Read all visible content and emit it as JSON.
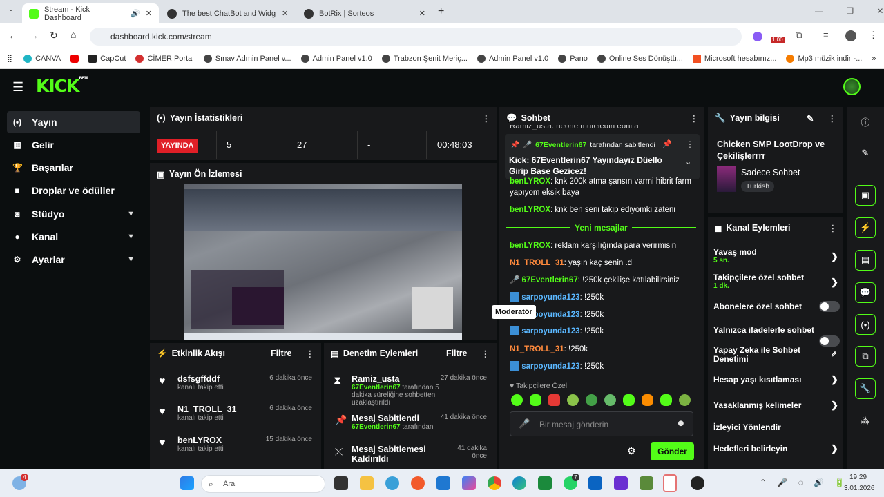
{
  "browser": {
    "tabs": [
      {
        "label": "Stream - Kick Dashboard"
      },
      {
        "label": "The best ChatBot and Widgets"
      },
      {
        "label": "BotRix | Sorteos"
      }
    ],
    "url": "dashboard.kick.com/stream",
    "ext_badge": "1.00",
    "bookmarks": [
      "CANVA",
      "CapCut",
      "CİMER Portal",
      "Sınav Admin Panel v...",
      "Admin Panel v1.0",
      "Trabzon Şenit Meriç...",
      "Admin Panel v1.0",
      "Pano",
      "Online Ses Dönüştü...",
      "Microsoft hesabınız...",
      "Mp3 müzik indir -..."
    ]
  },
  "app": {
    "logo": "KICK",
    "beta": "BETA",
    "nav": [
      {
        "label": "Yayın"
      },
      {
        "label": "Gelir"
      },
      {
        "label": "Başarılar"
      },
      {
        "label": "Droplar ve ödüller"
      },
      {
        "label": "Stüdyo"
      },
      {
        "label": "Kanal"
      },
      {
        "label": "Ayarlar"
      }
    ],
    "stats": {
      "title": "Yayın İstatistikleri",
      "live": "YAYINDA",
      "v1": "5",
      "v2": "27",
      "v3": "-",
      "time": "00:48:03"
    },
    "preview": {
      "title": "Yayın Ön İzlemesi"
    },
    "activity": {
      "title": "Etkinlik Akışı",
      "filter": "Filtre",
      "items": [
        {
          "user": "dsfsgffddf",
          "desc": "kanalı takip etti",
          "time": "6 dakika önce"
        },
        {
          "user": "N1_TROLL_31",
          "desc": "kanalı takip etti",
          "time": "6 dakika önce"
        },
        {
          "user": "benLYROX",
          "desc": "kanalı takip etti",
          "time": "15 dakika önce"
        }
      ]
    },
    "mod": {
      "title": "Denetim Eylemleri",
      "filter": "Filtre",
      "items": [
        {
          "user": "Ramiz_usta",
          "desc_user": "67Eventlerin67",
          "desc": "tarafından 5 dakika süreliğine sohbetten uzaklaştırıldı",
          "time": "27 dakika önce"
        },
        {
          "user": "Mesaj Sabitlendi",
          "desc_user": "67Eventlerin67",
          "desc": "tarafından",
          "time": "41 dakika önce"
        },
        {
          "user": "Mesaj Sabitlemesi Kaldırıldı",
          "time": "41 dakika önce"
        }
      ]
    },
    "chat": {
      "title": "Sohbet",
      "top_cut": "Ramiz_usta: neone müteledin ebni a",
      "pinned_by": "67Eventlerin67",
      "pinned_suffix": "tarafından sabitlendi",
      "pinned_msg": "Kick: 67Eventlerin67 Yayındayız Düello Girip Base Gezicez!",
      "m1_user": "benLYROX",
      "m1": ": knk 200k atma şansın varmi hibrit farm yapıyom eksik baya",
      "m2_user": "benLYROX",
      "m2": ": knk ben seni takip ediyomki zateni",
      "new": "Yeni mesajlar",
      "m3_user": "benLYROX",
      "m3": ": reklam karşılığında para verirmisin",
      "m4_user": "N1_TROLL_31",
      "m4": ": yaşın kaç senin .d",
      "m5_user": "67Eventlerin67",
      "m5": ": !250k çekilişe katılabilirsiniz",
      "m6_user": "sarpoyunda123",
      "m6": ": !250k",
      "m7_user": "sarpoyunda123",
      "m7": ": !250k",
      "m8_user": "sarpoyunda123",
      "m8": ": !250k",
      "m9_user": "N1_TROLL_31",
      "m9": ": !250k",
      "m10_user": "sarpoyunda123",
      "m10": ": !250k",
      "tooltip": "Moderatör",
      "followers_only": "Takipçilere Özel",
      "placeholder": "Bir mesaj gönderin",
      "send": "Gönder"
    },
    "info": {
      "title": "Yayın bilgisi",
      "stream_title": "Chicken SMP LootDrop ve Çekilişlerrrr",
      "category": "Sadece Sohbet",
      "tag": "Turkish"
    },
    "channel": {
      "title": "Kanal Eylemleri",
      "items": [
        {
          "label": "Yavaş mod",
          "sub": "5 sn."
        },
        {
          "label": "Takipçilere özel sohbet",
          "sub": "1 dk."
        },
        {
          "label": "Abonelere özel sohbet"
        },
        {
          "label": "Yalnızca ifadelerle sohbet"
        },
        {
          "label": "Yapay Zeka ile Sohbet Denetimi"
        },
        {
          "label": "Hesap yaşı kısıtlaması"
        },
        {
          "label": "Yasaklanmış kelimeler"
        },
        {
          "label": "İzleyici Yönlendir"
        },
        {
          "label": "Hedefleri belirleyin"
        }
      ]
    }
  },
  "taskbar": {
    "search": "Ara",
    "time": "19:29",
    "date": "3.01.2026",
    "notif": "4",
    "whatsapp_badge": "7"
  },
  "colors": {
    "accent": "#53fc18",
    "live": "#e01f27",
    "panel": "#18191b"
  }
}
